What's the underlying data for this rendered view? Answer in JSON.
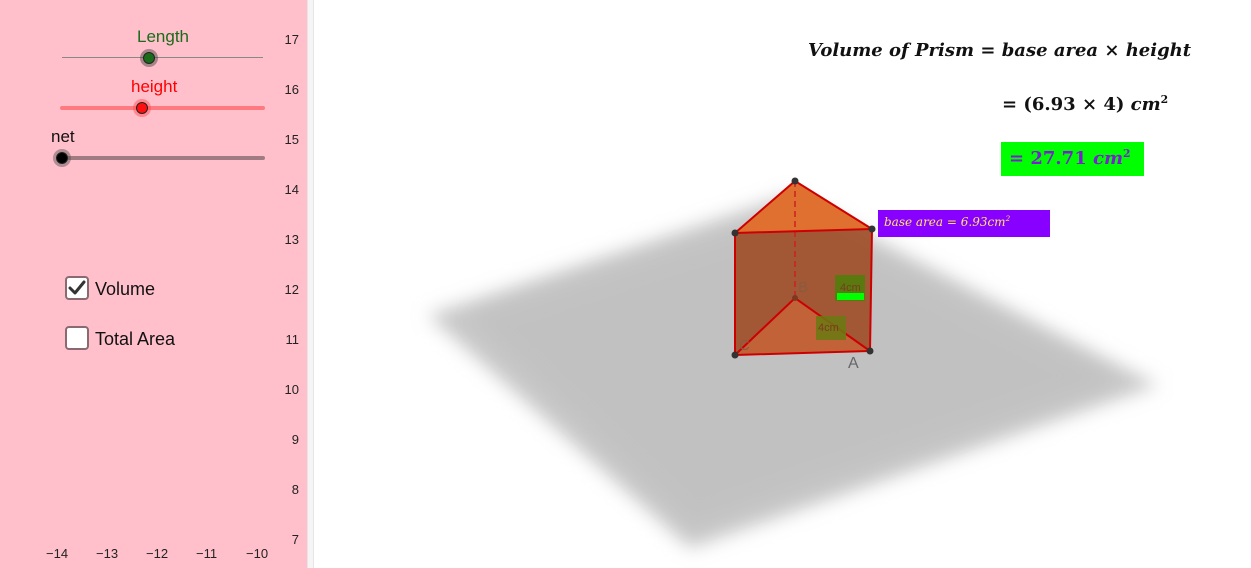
{
  "sliders": [
    {
      "label": "Length",
      "color": "#1a6b1a",
      "fraction": 0.43
    },
    {
      "label": "height",
      "color": "#ff0000",
      "fraction": 0.4
    },
    {
      "label": "net",
      "color": "#000000",
      "fraction": 0.0
    }
  ],
  "checkboxes": [
    {
      "label": "Volume",
      "checked": true
    },
    {
      "label": "Total Area",
      "checked": false
    }
  ],
  "axis": {
    "y_ticks": [
      "17",
      "16",
      "15",
      "14",
      "13",
      "12",
      "11",
      "10",
      "9",
      "8",
      "7"
    ],
    "x_ticks": [
      "−14",
      "−13",
      "−12",
      "−11",
      "−10"
    ]
  },
  "formula": {
    "line1_left": "Volume of Prism",
    "line1_right": "base area × height",
    "eq": "=",
    "line2_prefix": "= (6.93 × 4) ",
    "line2_unit": "cm",
    "line2_exp": "2",
    "result_prefix": "= 27.71 ",
    "result_unit": "cm",
    "result_exp": "2",
    "result_bg": "#00ff00",
    "result_color": "#7a1fd0"
  },
  "base_area_label": {
    "text": "base area = 6.93cm",
    "exp": "2",
    "bg": "#8800ff",
    "color": "#ffe36b"
  },
  "prism": {
    "points": {
      "A": "A",
      "B": "B",
      "C": "C"
    },
    "length_label": "4cm",
    "side_label": "4cm",
    "fill": "#a0522d",
    "top_fill": "#e07030",
    "edge": "#cc0000"
  }
}
